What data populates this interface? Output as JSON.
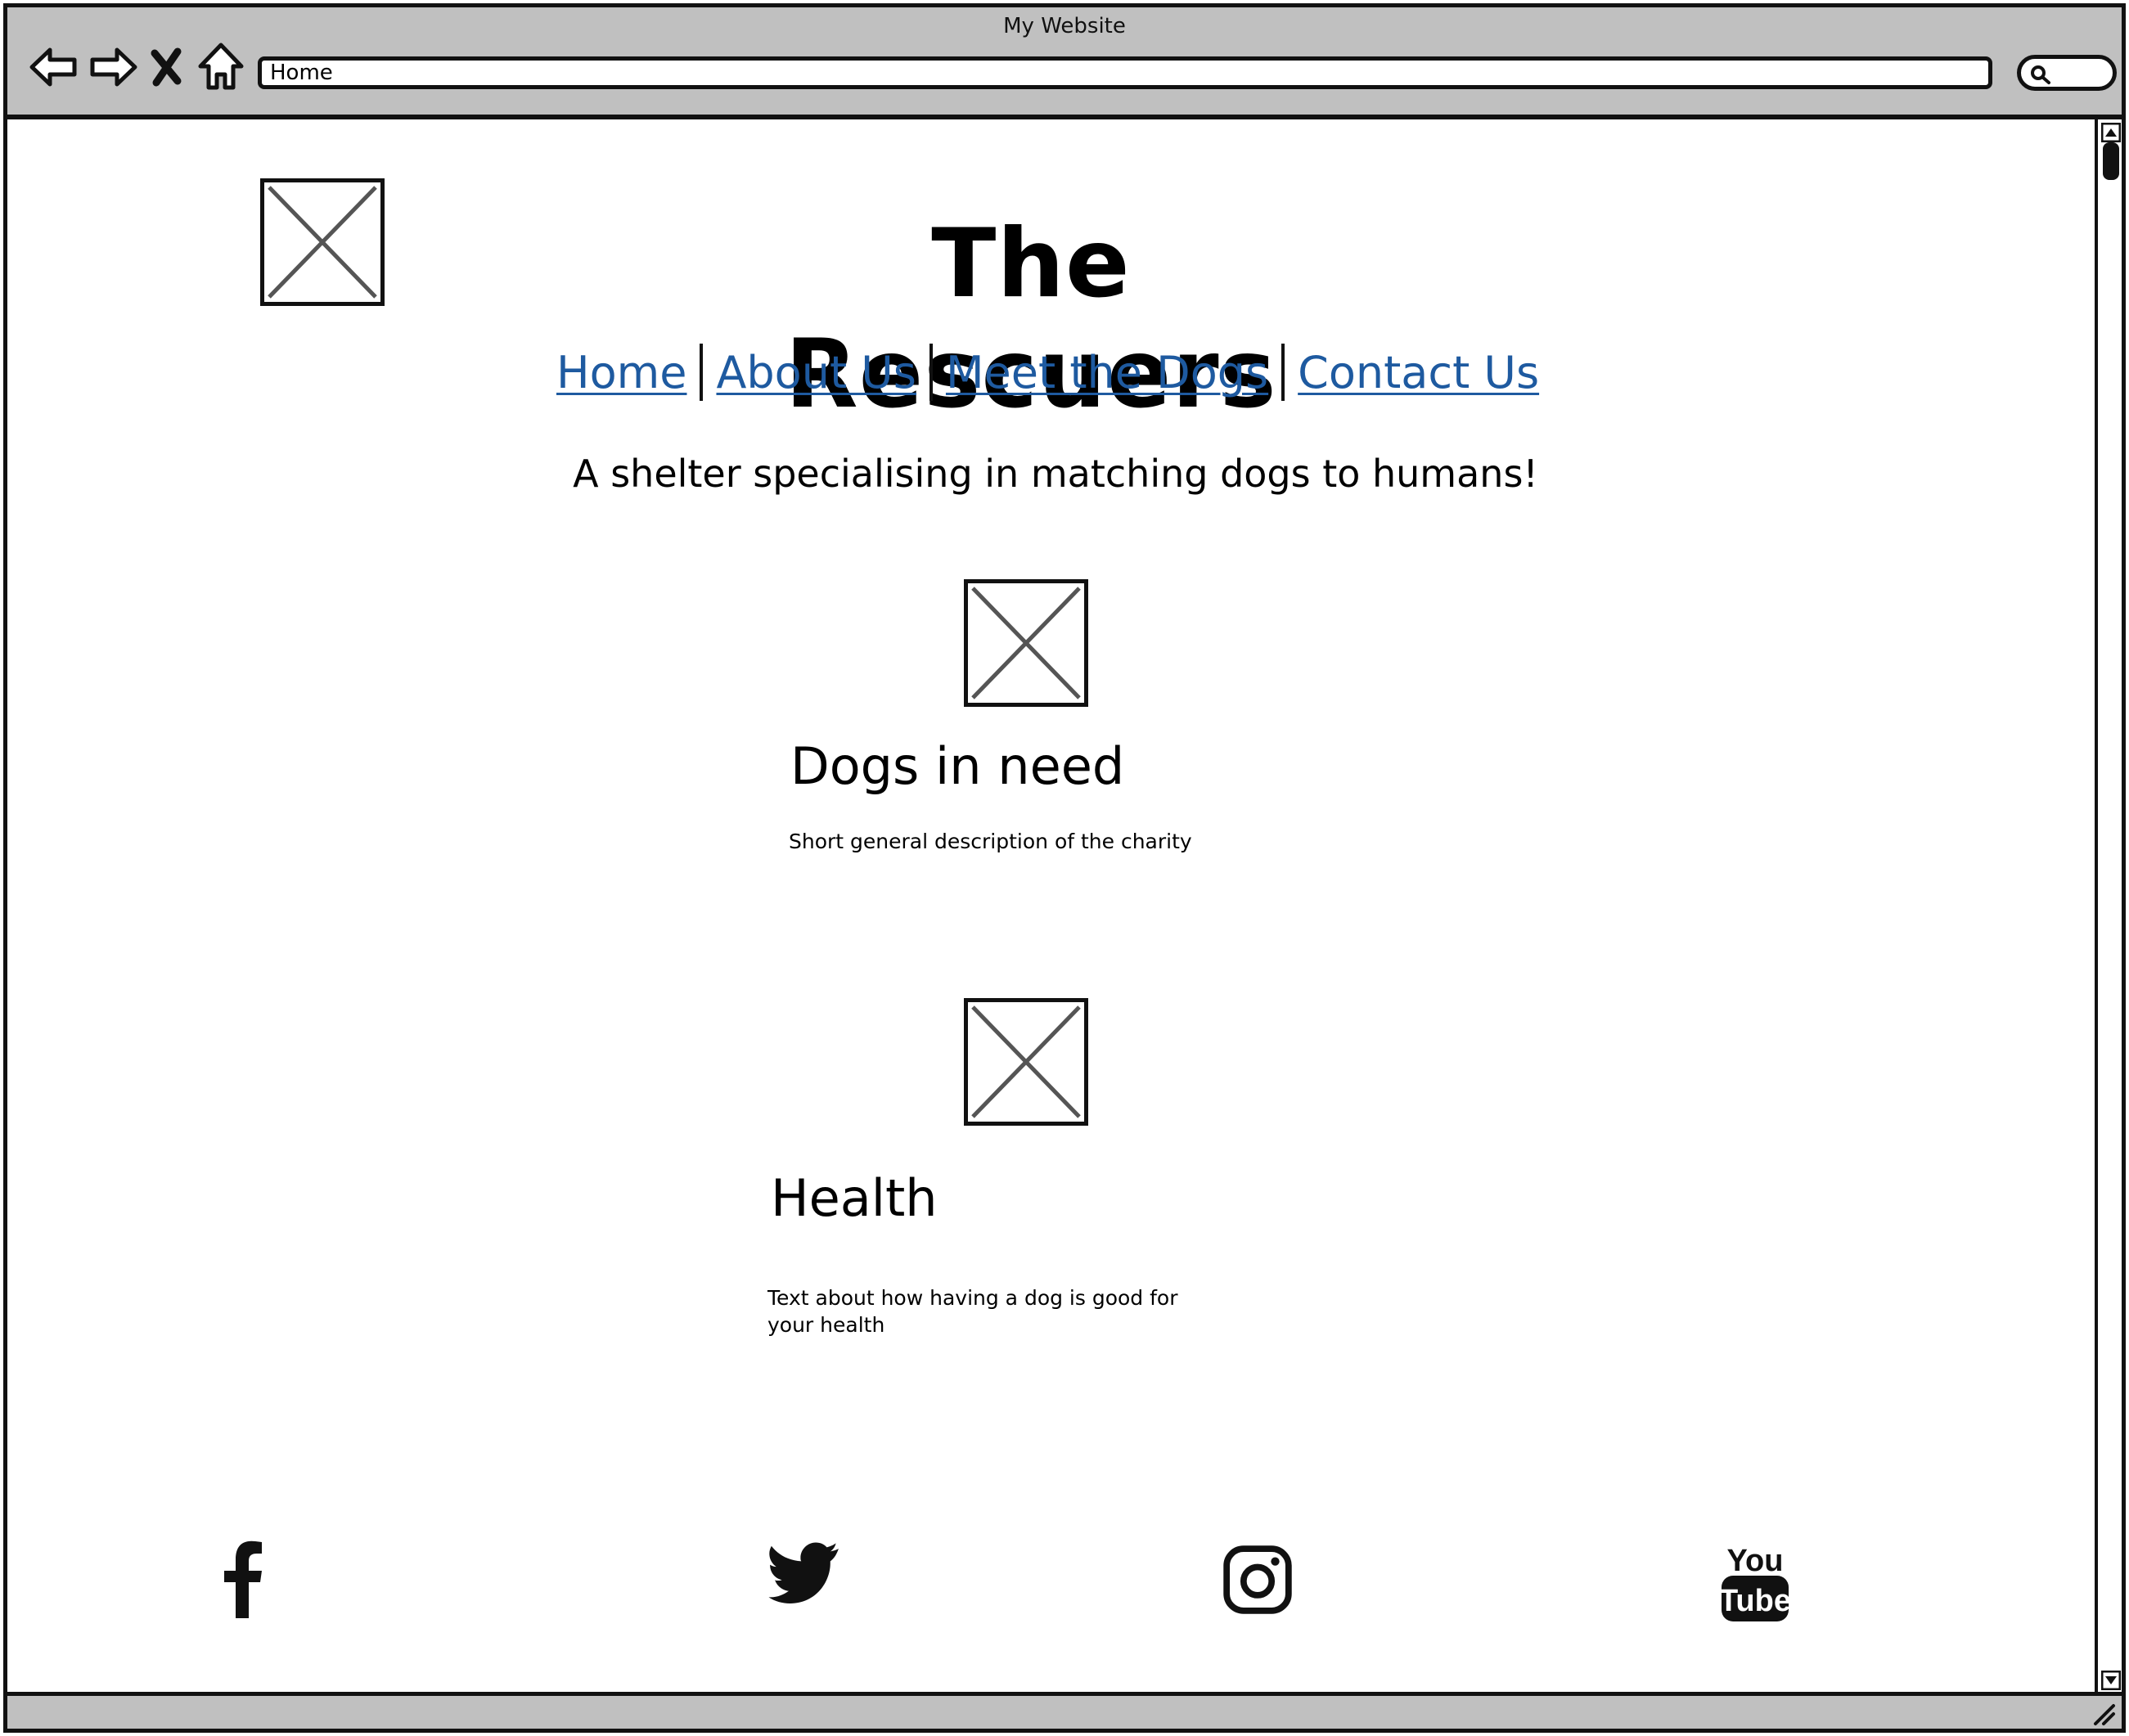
{
  "window": {
    "title": "My Website",
    "url": "Home"
  },
  "site": {
    "title": "The Rescuers",
    "tagline": "A shelter specialising in matching dogs to humans!"
  },
  "nav": {
    "items": [
      {
        "label": "Home"
      },
      {
        "label": "About Us"
      },
      {
        "label": "Meet the Dogs"
      },
      {
        "label": "Contact Us"
      }
    ]
  },
  "sections": [
    {
      "heading": "Dogs in need",
      "body": "Short general description of the charity"
    },
    {
      "heading": "Health",
      "body": "Text about how having a dog is good for your health"
    }
  ],
  "social": [
    {
      "icon": "facebook-icon"
    },
    {
      "icon": "twitter-icon"
    },
    {
      "icon": "instagram-icon"
    },
    {
      "icon": "youtube-icon",
      "text_top": "You",
      "text_bottom": "Tube"
    }
  ],
  "colors": {
    "link": "#1e5aa0",
    "chrome": "#c0c0c0"
  }
}
